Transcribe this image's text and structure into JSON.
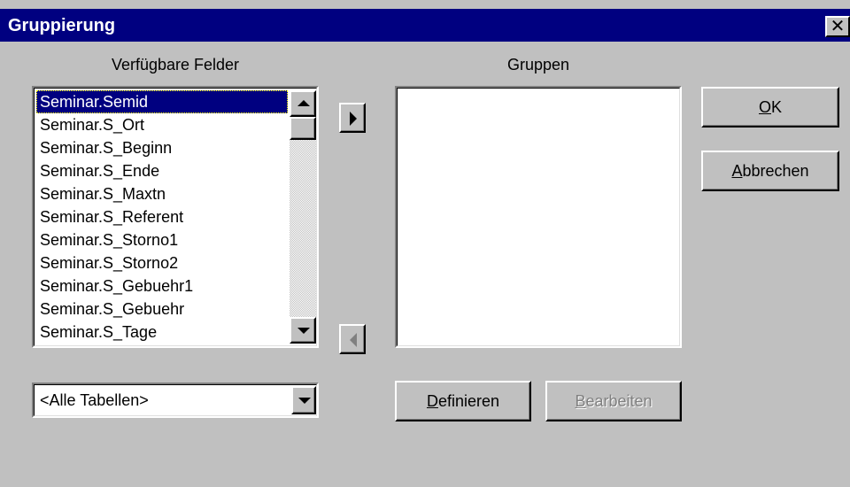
{
  "window": {
    "title": "Gruppierung",
    "close_glyph": "✕"
  },
  "available": {
    "label": "Verfügbare Felder",
    "items": [
      "Seminar.Semid",
      "Seminar.S_Ort",
      "Seminar.S_Beginn",
      "Seminar.S_Ende",
      "Seminar.S_Maxtn",
      "Seminar.S_Referent",
      "Seminar.S_Storno1",
      "Seminar.S_Storno2",
      "Seminar.S_Gebuehr1",
      "Seminar.S_Gebuehr",
      "Seminar.S_Tage"
    ],
    "selected_index": 0
  },
  "groups": {
    "label": "Gruppen",
    "items": []
  },
  "table_filter": {
    "value": "<Alle Tabellen>"
  },
  "buttons": {
    "ok": {
      "mnemonic": "O",
      "rest": "K"
    },
    "cancel": {
      "mnemonic": "A",
      "rest": "bbrechen"
    },
    "define": {
      "mnemonic": "D",
      "rest": "efinieren"
    },
    "edit": {
      "mnemonic": "B",
      "rest": "earbeiten"
    }
  },
  "icons": {
    "move_right": "right-arrow-icon",
    "move_left": "left-arrow-icon",
    "scroll_up": "scroll-up-icon",
    "scroll_down": "scroll-down-icon",
    "dropdown": "chevron-down-icon",
    "close": "close-icon"
  },
  "colors": {
    "title_bar": "#000080",
    "dialog_bg": "#c0c0c0",
    "selection": "#000080"
  }
}
